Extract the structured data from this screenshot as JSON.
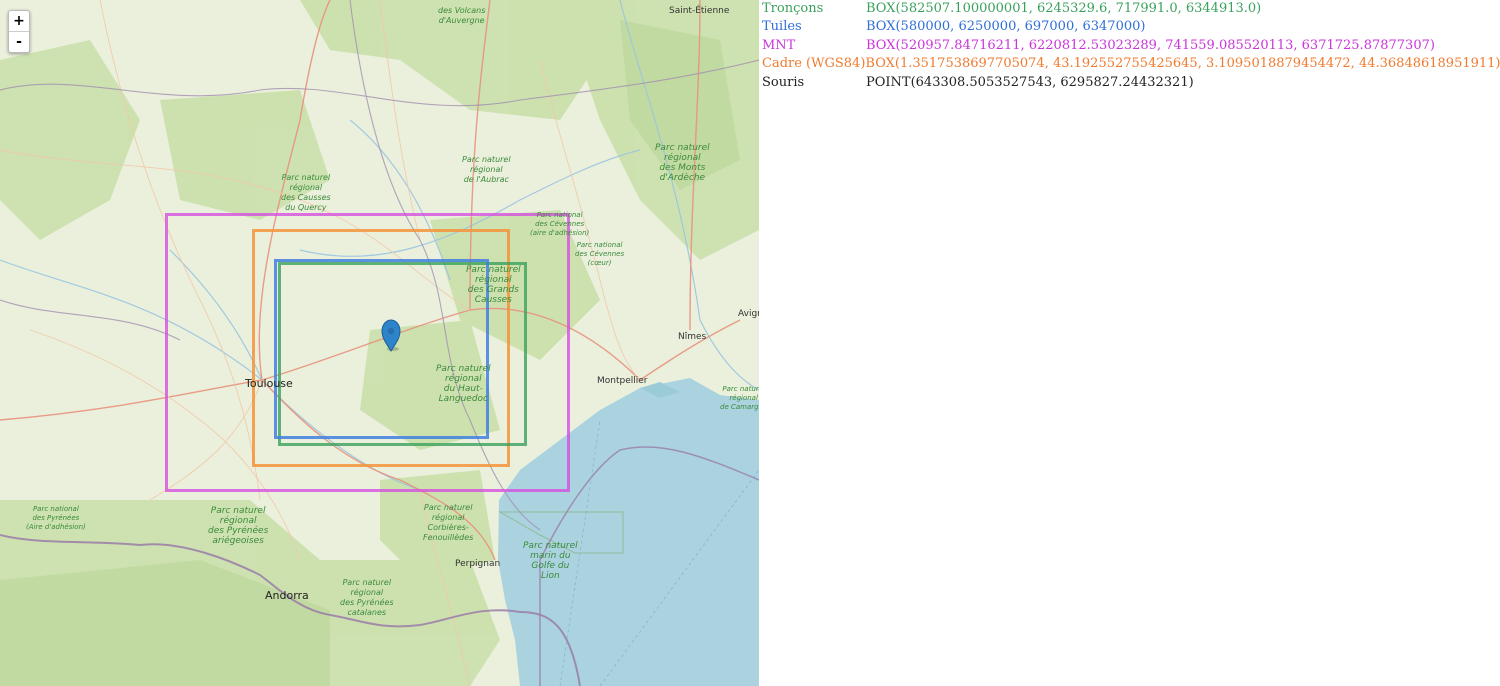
{
  "map": {
    "zoom_in": "+",
    "zoom_out": "-",
    "cities": [
      {
        "id": "toulouse",
        "label": "Toulouse"
      },
      {
        "id": "montpellier",
        "label": "Montpellier"
      },
      {
        "id": "nimes",
        "label": "Nîmes"
      },
      {
        "id": "perpignan",
        "label": "Perpignan"
      },
      {
        "id": "andorra",
        "label": "Andorra"
      },
      {
        "id": "saint-etienne",
        "label": "Saint-Étienne"
      },
      {
        "id": "avignon",
        "label": "Avign"
      }
    ],
    "parks": [
      {
        "id": "volcans",
        "label": "des Volcans\nd'Auvergne"
      },
      {
        "id": "aubrac",
        "label": "Parc naturel\nrégional\nde l'Aubrac"
      },
      {
        "id": "ardeche",
        "label": "Parc naturel\nrégional\ndes Monts\nd'Ardèche"
      },
      {
        "id": "quercy",
        "label": "Parc naturel\nrégional\ndes Causses\ndu Quercy"
      },
      {
        "id": "cevennes-adhesion",
        "label": "Parc national\ndes Cévennes\n(aire d'adhésion)"
      },
      {
        "id": "cevennes-coeur",
        "label": "Parc national\ndes Cévennes\n(cœur)"
      },
      {
        "id": "grands-causses",
        "label": "Parc naturel\nrégional\ndes Grands\nCausses"
      },
      {
        "id": "haut-languedoc",
        "label": "Parc naturel\nrégional\ndu Haut-\nLanguedoc"
      },
      {
        "id": "camargue",
        "label": "Parc naturel\nrégional\nde Camargue"
      },
      {
        "id": "pyrenees-national",
        "label": "Parc national\ndes Pyrénées\n(Aire d'adhésion)"
      },
      {
        "id": "pyrenees-ariegeoises",
        "label": "Parc naturel\nrégional\ndes Pyrénées\nariégeoises"
      },
      {
        "id": "corbieres",
        "label": "Parc naturel\nrégional\nCorbières-\nFenouillèdes"
      },
      {
        "id": "golfe-lion",
        "label": "Parc naturel\nmarin du\nGolfe du\nLion"
      },
      {
        "id": "pyrenees-catalanes",
        "label": "Parc naturel\nrégional\ndes Pyrénées\ncatalanes"
      }
    ],
    "colors": {
      "land": "#eaf0dc",
      "forest": "#c8dfa8",
      "sea": "#aad3df",
      "troncons": "#3aa15c",
      "tuiles": "#3f7fe0",
      "mnt": "#d64fe0",
      "cadre": "#f5933b",
      "marker": "#2e84cb"
    }
  },
  "panel": {
    "rows": [
      {
        "key": "Tronçons",
        "value": "BOX(582507.100000001, 6245329.6, 717991.0, 6344913.0)",
        "color": "#3aa15c"
      },
      {
        "key": "Tuiles",
        "value": "BOX(580000, 6250000, 697000, 6347000)",
        "color": "#2f6fd8"
      },
      {
        "key": "MNT",
        "value": "BOX(520957.84716211, 6220812.53023289, 741559.085520113, 6371725.87877307)",
        "color": "#cc33dd"
      },
      {
        "key": "Cadre (WGS84)",
        "value": "BOX(1.3517538697705074, 43.192552755425645, 3.1095018879454472, 44.36848618951911)",
        "color": "#f07a2e"
      },
      {
        "key": "Souris",
        "value": "POINT(643308.5053527543, 6295827.24432321)",
        "color": "#222222"
      }
    ]
  }
}
